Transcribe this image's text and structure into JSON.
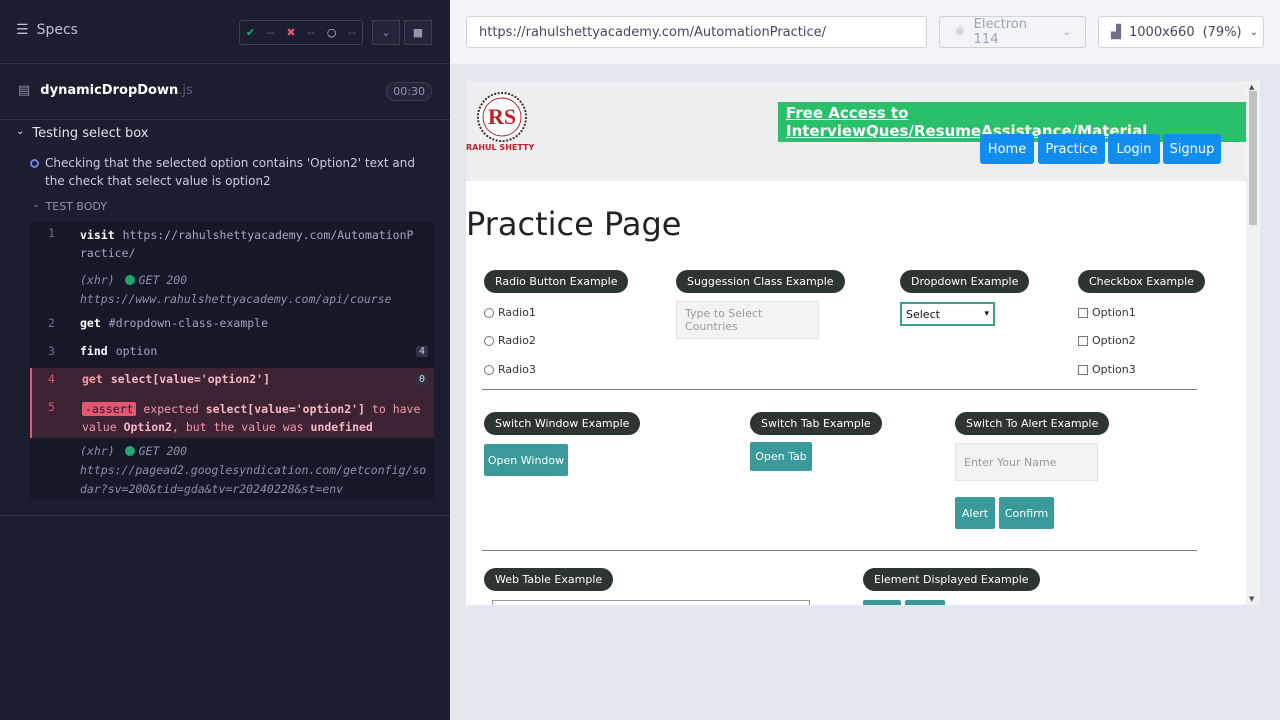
{
  "reporter": {
    "specs_label": "Specs",
    "stats": {
      "passed": "--",
      "failed": "--",
      "pending": "--"
    },
    "spec_file": {
      "name": "dynamicDropDown",
      "ext": ".js",
      "duration": "00:30"
    },
    "suite_title": "Testing select box",
    "test_title": "Checking that the selected option contains 'Option2' text and the check that select value is option2",
    "body_label": "TEST BODY",
    "commands": [
      {
        "num": "1",
        "name": "visit",
        "message": "https://rahulshettyacademy.com/AutomationPractice/"
      },
      {
        "xhr_label": "(xhr)",
        "status": "GET 200",
        "url": "https://www.rahulshettyacademy.com/api/course"
      },
      {
        "num": "2",
        "name": "get",
        "message": "#dropdown-class-example"
      },
      {
        "num": "3",
        "name": "find",
        "message": "option",
        "count": "4"
      },
      {
        "num": "4",
        "name": "get",
        "message": "select[value='option2']",
        "count": "0"
      },
      {
        "num": "5",
        "name": "-assert",
        "m1": "expected",
        "m2": "select[value='option2']",
        "m3": "to have value",
        "m4": "Option2",
        "m5": ", but the value was",
        "m6": "undefined"
      },
      {
        "xhr_label": "(xhr)",
        "status": "GET 200",
        "url": "https://pagead2.googlesyndication.com/getconfig/sodar?sv=200&tid=gda&tv=r20240228&st=env"
      }
    ]
  },
  "topbar": {
    "url": "https://rahulshettyacademy.com/AutomationPractice/",
    "browser": "Electron 114",
    "viewport": "1000x660",
    "zoom": "(79%)"
  },
  "aut": {
    "logo_text": "RAHUL SHETTY",
    "banner": "Free Access to InterviewQues/ResumeAssistance/Material",
    "nav": [
      "Home",
      "Practice",
      "Login",
      "Signup"
    ],
    "page_title": "Practice Page",
    "radio_section": "Radio Button Example",
    "radios": [
      "Radio1",
      "Radio2",
      "Radio3"
    ],
    "suggestion_section": "Suggession Class Example",
    "suggestion_placeholder": "Type to Select Countries",
    "dropdown_section": "Dropdown Example",
    "dropdown_value": "Select",
    "checkbox_section": "Checkbox Example",
    "checkboxes": [
      "Option1",
      "Option2",
      "Option3"
    ],
    "switch_window_section": "Switch Window Example",
    "open_window": "Open Window",
    "switch_tab_section": "Switch Tab Example",
    "open_tab": "Open Tab",
    "alert_section": "Switch To Alert Example",
    "name_placeholder": "Enter Your Name",
    "alert_btn": "Alert",
    "confirm_btn": "Confirm",
    "web_table_section": "Web Table Example",
    "element_displayed_section": "Element Displayed Example"
  },
  "colors": {
    "reporter_bg": "#1b1e2e",
    "pass": "#1fa971",
    "fail": "#e45770",
    "nav_blue": "#118df0",
    "banner_green": "#2ac06b",
    "teal": "#3a9a9a"
  }
}
